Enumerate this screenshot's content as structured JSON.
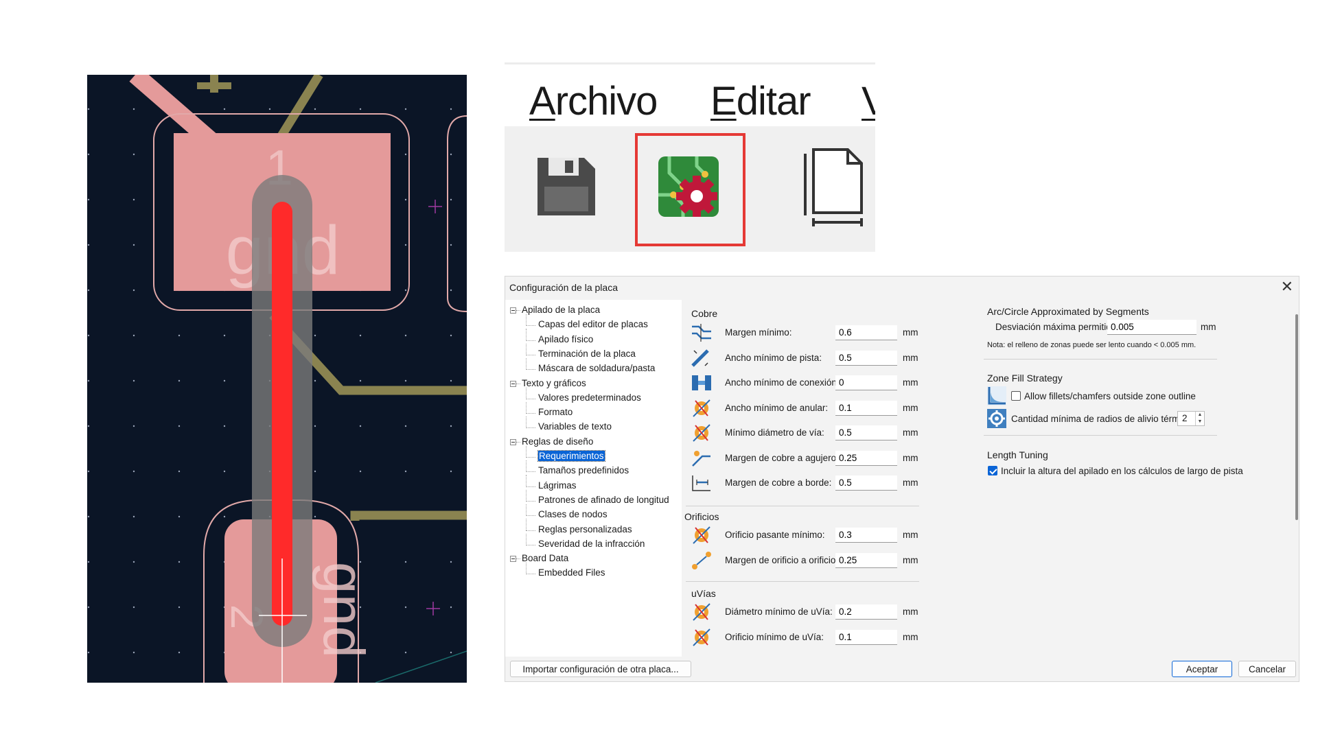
{
  "pcb": {
    "pad1_number": "1",
    "pad1_net": "gnd",
    "pad2_number": "2",
    "pad2_net": "gnd"
  },
  "zoom": {
    "menu": {
      "archivo": {
        "underline": "A",
        "rest": "rchivo"
      },
      "editar": {
        "underline": "E",
        "rest": "ditar"
      },
      "cut": "V"
    },
    "icons": [
      "save-icon",
      "board-setup-icon",
      "page-settings-icon"
    ],
    "highlight_color": "#e53935"
  },
  "dialog": {
    "title": "Configuración de la placa",
    "close": "✕",
    "tree": [
      {
        "label": "Apilado de la placa",
        "level": 0
      },
      {
        "label": "Capas del editor de placas",
        "level": 1
      },
      {
        "label": "Apilado físico",
        "level": 1
      },
      {
        "label": "Terminación de la placa",
        "level": 1
      },
      {
        "label": "Máscara de soldadura/pasta",
        "level": 1
      },
      {
        "label": "Texto y gráficos",
        "level": 0
      },
      {
        "label": "Valores predeterminados",
        "level": 1
      },
      {
        "label": "Formato",
        "level": 1
      },
      {
        "label": "Variables de texto",
        "level": 1
      },
      {
        "label": "Reglas de diseño",
        "level": 0
      },
      {
        "label": "Requerimientos",
        "level": 1,
        "selected": true
      },
      {
        "label": "Tamaños predefinidos",
        "level": 1
      },
      {
        "label": "Lágrimas",
        "level": 1
      },
      {
        "label": "Patrones de afinado de longitud",
        "level": 1
      },
      {
        "label": "Clases de nodos",
        "level": 1
      },
      {
        "label": "Reglas personalizadas",
        "level": 1
      },
      {
        "label": "Severidad de la infracción",
        "level": 1
      },
      {
        "label": "Board Data",
        "level": 0
      },
      {
        "label": "Embedded Files",
        "level": 1
      }
    ],
    "copper": {
      "title": "Cobre",
      "rows": [
        {
          "label": "Margen mínimo:",
          "value": "0.6",
          "unit": "mm",
          "icon": "clearance-icon"
        },
        {
          "label": "Ancho mínimo de pista:",
          "value": "0.5",
          "unit": "mm",
          "icon": "track-width-icon"
        },
        {
          "label": "Ancho mínimo de conexión:",
          "value": "0",
          "unit": "mm",
          "icon": "connection-width-icon"
        },
        {
          "label": "Ancho mínimo de anular:",
          "value": "0.1",
          "unit": "mm",
          "icon": "annular-width-icon"
        },
        {
          "label": "Mínimo diámetro de vía:",
          "value": "0.5",
          "unit": "mm",
          "icon": "via-diameter-icon"
        },
        {
          "label": "Margen de cobre a agujero:",
          "value": "0.25",
          "unit": "mm",
          "icon": "hole-clearance-icon"
        },
        {
          "label": "Margen de cobre a borde:",
          "value": "0.5",
          "unit": "mm",
          "icon": "edge-clearance-icon"
        }
      ]
    },
    "holes": {
      "title": "Orificios",
      "rows": [
        {
          "label": "Orificio pasante mínimo:",
          "value": "0.3",
          "unit": "mm",
          "icon": "through-hole-icon"
        },
        {
          "label": "Margen de orificio a orificio:",
          "value": "0.25",
          "unit": "mm",
          "icon": "hole-to-hole-icon"
        }
      ]
    },
    "uvias": {
      "title": "uVías",
      "rows": [
        {
          "label": "Diámetro mínimo de uVía:",
          "value": "0.2",
          "unit": "mm",
          "icon": "uvia-diameter-icon"
        },
        {
          "label": "Orificio mínimo de uVía:",
          "value": "0.1",
          "unit": "mm",
          "icon": "uvia-hole-icon"
        }
      ]
    },
    "arc": {
      "title": "Arc/Circle Approximated by Segments",
      "label": "Desviación máxima permitida:",
      "value": "0.005",
      "unit": "mm",
      "note": "Nota: el relleno de zonas puede ser lento cuando < 0.005 mm."
    },
    "zone": {
      "title": "Zone Fill Strategy",
      "allow_fillets": "Allow fillets/chamfers outside zone outline",
      "allow_fillets_checked": false,
      "thermal_label": "Cantidad mínima de radios de alivio térmico:",
      "thermal_value": "2"
    },
    "length": {
      "title": "Length Tuning",
      "label": "Incluir la altura del apilado en los cálculos de largo de pista",
      "checked": true
    },
    "import_button": "Importar configuración de otra placa...",
    "ok_button": "Aceptar",
    "cancel_button": "Cancelar"
  }
}
